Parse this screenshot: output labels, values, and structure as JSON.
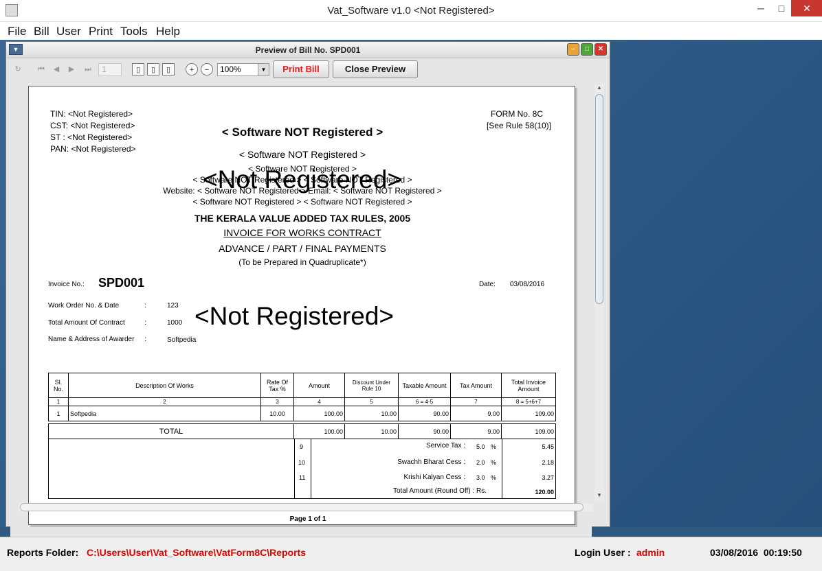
{
  "app": {
    "title": "Vat_Software v1.0 <Not Registered>",
    "minimize": "─",
    "maximize": "□",
    "close": "✕"
  },
  "menu": [
    "File",
    "Bill",
    "User",
    "Print",
    "Tools",
    "Help"
  ],
  "preview": {
    "title": "Preview of Bill No. SPD001",
    "page_number": "1",
    "zoom": "100%",
    "print_label": "Print Bill",
    "close_label": "Close Preview",
    "page_indicator": "Page 1 of 1"
  },
  "invoice": {
    "tin": "TIN: <Not Registered>",
    "cst": "CST: <Not Registered>",
    "st": "ST : <Not Registered>",
    "pan": "PAN: <Not Registered>",
    "form_no": "FORM No. 8C",
    "rule": "[See Rule 58(10)]",
    "company": "< Software NOT Registered >",
    "company2": "< Software NOT Registered >",
    "addr1": "< Software NOT Registered >",
    "addr2": "< Software NOT Registered > < Software NOT Registered >",
    "website_line": "Website: < Software NOT Registered > Email: < Software NOT Registered >",
    "addr3": "< Software NOT Registered > < Software NOT Registered >",
    "watermark1": "<Not Registered>",
    "watermark2": "<Not Registered>",
    "act": "THE KERALA VALUE ADDED TAX RULES, 2005",
    "heading": "INVOICE FOR WORKS CONTRACT",
    "sub": "ADVANCE / PART / FINAL PAYMENTS",
    "note": "(To be Prepared in Quadruplicate*)",
    "invoice_label": "Invoice No.:",
    "invoice_no": "SPD001",
    "date_label": "Date:",
    "date": "03/08/2016",
    "work_order_label": "Work Order No. & Date",
    "work_order": "123",
    "contract_label": "Total Amount Of Contract",
    "contract": "1000",
    "awarder_label": "Name & Address of Awarder",
    "awarder": "Softpedia",
    "colon": ":",
    "headers": [
      "Sl. No.",
      "Description Of Works",
      "Rate Of Tax %",
      "Amount",
      "Discount Under Rule 10",
      "Taxable Amount",
      "Tax Amount",
      "Total Invoice Amount"
    ],
    "col_nums": [
      "1",
      "2",
      "3",
      "4",
      "5",
      "6 = 4-5",
      "7",
      "8 = 5+6+7"
    ],
    "row": [
      "1",
      "Softpedia",
      "10.00",
      "100.00",
      "10.00",
      "90.00",
      "9.00",
      "109.00"
    ],
    "total_label": "TOTAL",
    "totals": [
      "100.00",
      "10.00",
      "90.00",
      "9.00",
      "109.00"
    ],
    "taxes": [
      {
        "no": "9",
        "label": "Service Tax :",
        "rate": "5.0",
        "pct": "%",
        "value": "5.45"
      },
      {
        "no": "10",
        "label": "Swachh Bharat Cess :",
        "rate": "2.0",
        "pct": "%",
        "value": "2.18"
      },
      {
        "no": "11",
        "label": "Krishi Kalyan Cess :",
        "rate": "3.0",
        "pct": "%",
        "value": "3.27"
      }
    ],
    "round_label": "Total Amount (Round Off) : Rs.",
    "round_value": "120.00"
  },
  "status": {
    "folder_label": "Reports Folder:",
    "folder": "C:\\Users\\User\\Vat_Software\\VatForm8C\\Reports",
    "user_label": "Login User :",
    "user": "admin",
    "datetime": "03/08/2016  00:19:50",
    "accent": "#e00000"
  }
}
